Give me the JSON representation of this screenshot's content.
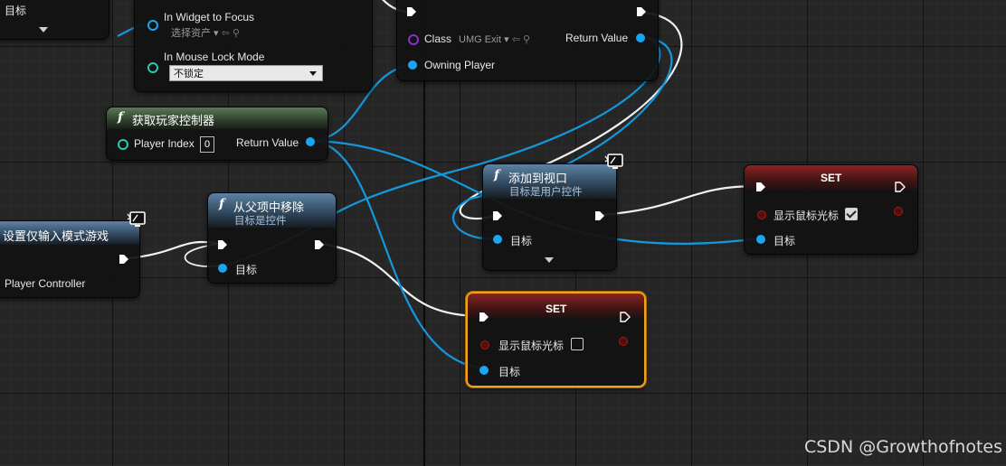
{
  "top_left_node": {
    "pin_label": "目标"
  },
  "widget_focus_node": {
    "in_widget_to_focus": "In Widget to Focus",
    "asset_placeholder": "选择资产",
    "in_mouse_lock_mode": "In Mouse Lock Mode",
    "mouse_lock_value": "不锁定"
  },
  "create_widget_node": {
    "class_label": "Class",
    "class_value": "UMG Exit",
    "return_value": "Return Value",
    "owning_player": "Owning Player"
  },
  "get_player_controller": {
    "title": "获取玩家控制器",
    "player_index_label": "Player Index",
    "player_index_value": "0",
    "return_value": "Return Value"
  },
  "set_input_mode_node": {
    "title": "设置仅输入模式游戏",
    "player_controller": "Player Controller"
  },
  "remove_from_parent": {
    "title": "从父项中移除",
    "subtitle": "目标是控件",
    "target": "目标"
  },
  "add_to_viewport": {
    "title": "添加到视口",
    "subtitle": "目标是用户控件",
    "target": "目标"
  },
  "set_node_top": {
    "title": "SET",
    "show_cursor_label": "显示鼠标光标",
    "checked": true,
    "target": "目标"
  },
  "set_node_bottom": {
    "title": "SET",
    "show_cursor_label": "显示鼠标光标",
    "checked": false,
    "target": "目标"
  },
  "watermark": "CSDN @Growthofnotes",
  "colors": {
    "exec": "#ffffff",
    "object_pin": "#19a6f0",
    "bool_pin": "#a21a1a",
    "selection": "#f2a21a"
  }
}
